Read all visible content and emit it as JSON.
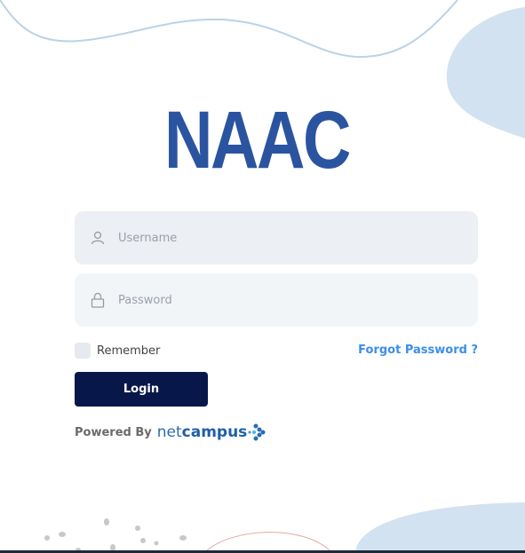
{
  "logo": {
    "text": "NAAC",
    "color": "#2b54a0"
  },
  "form": {
    "username": {
      "placeholder": "Username",
      "value": "",
      "icon": "user-icon"
    },
    "password": {
      "placeholder": "Password",
      "value": "",
      "icon": "lock-icon"
    },
    "remember_label": "Remember",
    "remember_checked": false,
    "forgot_label": "Forgot Password ?",
    "login_label": "Login"
  },
  "footer": {
    "powered_by": "Powered By",
    "brand_light": "net",
    "brand_bold": "campus"
  },
  "colors": {
    "primary": "#08174a",
    "link": "#3b8ee8",
    "decor": "#d3e2f0"
  }
}
